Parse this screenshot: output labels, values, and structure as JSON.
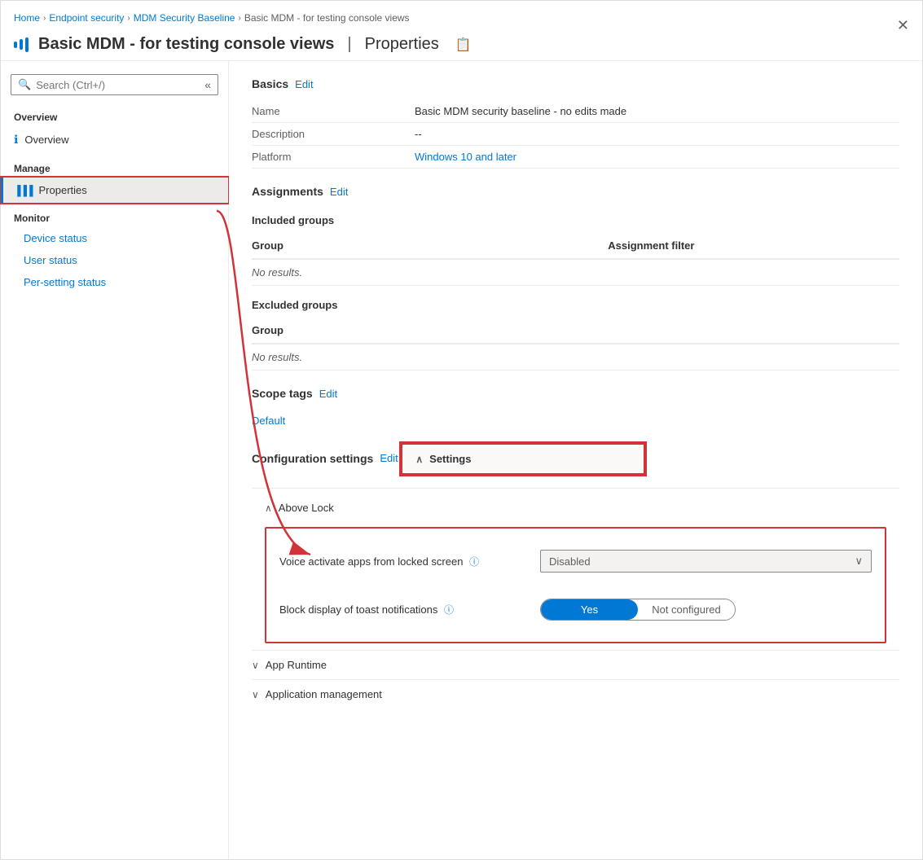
{
  "breadcrumb": {
    "items": [
      "Home",
      "Endpoint security",
      "MDM Security Baseline",
      "Basic MDM - for testing console views"
    ]
  },
  "header": {
    "title": "Basic MDM - for testing console views",
    "divider": "|",
    "section": "Properties",
    "pin_icon": "📌",
    "close_icon": "✕"
  },
  "sidebar": {
    "search_placeholder": "Search (Ctrl+/)",
    "collapse_icon": "«",
    "sections": [
      {
        "label": "Overview",
        "items": [
          {
            "id": "overview",
            "label": "Overview",
            "icon": "ℹ",
            "active": false,
            "sub": false
          }
        ]
      },
      {
        "label": "Manage",
        "items": [
          {
            "id": "properties",
            "label": "Properties",
            "icon": "|||",
            "active": true,
            "sub": false
          }
        ]
      },
      {
        "label": "Monitor",
        "items": [
          {
            "id": "device-status",
            "label": "Device status",
            "active": false,
            "sub": true
          },
          {
            "id": "user-status",
            "label": "User status",
            "active": false,
            "sub": true
          },
          {
            "id": "per-setting-status",
            "label": "Per-setting status",
            "active": false,
            "sub": true
          }
        ]
      }
    ]
  },
  "main": {
    "basics": {
      "section_title": "Basics",
      "edit_label": "Edit",
      "properties": [
        {
          "label": "Name",
          "value": "Basic MDM security baseline - no edits made",
          "is_link": false
        },
        {
          "label": "Description",
          "value": "--",
          "is_link": false
        },
        {
          "label": "Platform",
          "value": "Windows 10 and later",
          "is_link": true
        }
      ]
    },
    "assignments": {
      "section_title": "Assignments",
      "edit_label": "Edit",
      "included_groups": {
        "title": "Included groups",
        "col_group": "Group",
        "col_filter": "Assignment filter",
        "no_results": "No results."
      },
      "excluded_groups": {
        "title": "Excluded groups",
        "col_group": "Group",
        "no_results": "No results."
      }
    },
    "scope_tags": {
      "section_title": "Scope tags",
      "edit_label": "Edit",
      "default_tag": "Default"
    },
    "configuration_settings": {
      "section_title": "Configuration settings",
      "edit_label": "Edit",
      "settings_accordion": {
        "label": "Settings",
        "chevron_up": "∧"
      },
      "above_lock": {
        "label": "Above Lock",
        "chevron": "∧"
      },
      "settings_box": {
        "voice_activate": {
          "label": "Voice activate apps from locked screen",
          "info_icon": "ⓘ",
          "value": "Disabled",
          "chevron": "∨"
        },
        "block_toast": {
          "label": "Block display of toast notifications",
          "info_icon": "ⓘ",
          "toggle_yes": "Yes",
          "toggle_not_configured": "Not configured",
          "selected": "Yes"
        }
      },
      "app_runtime": {
        "label": "App Runtime",
        "chevron": "∨"
      },
      "application_management": {
        "label": "Application management",
        "chevron": "∨"
      }
    }
  }
}
